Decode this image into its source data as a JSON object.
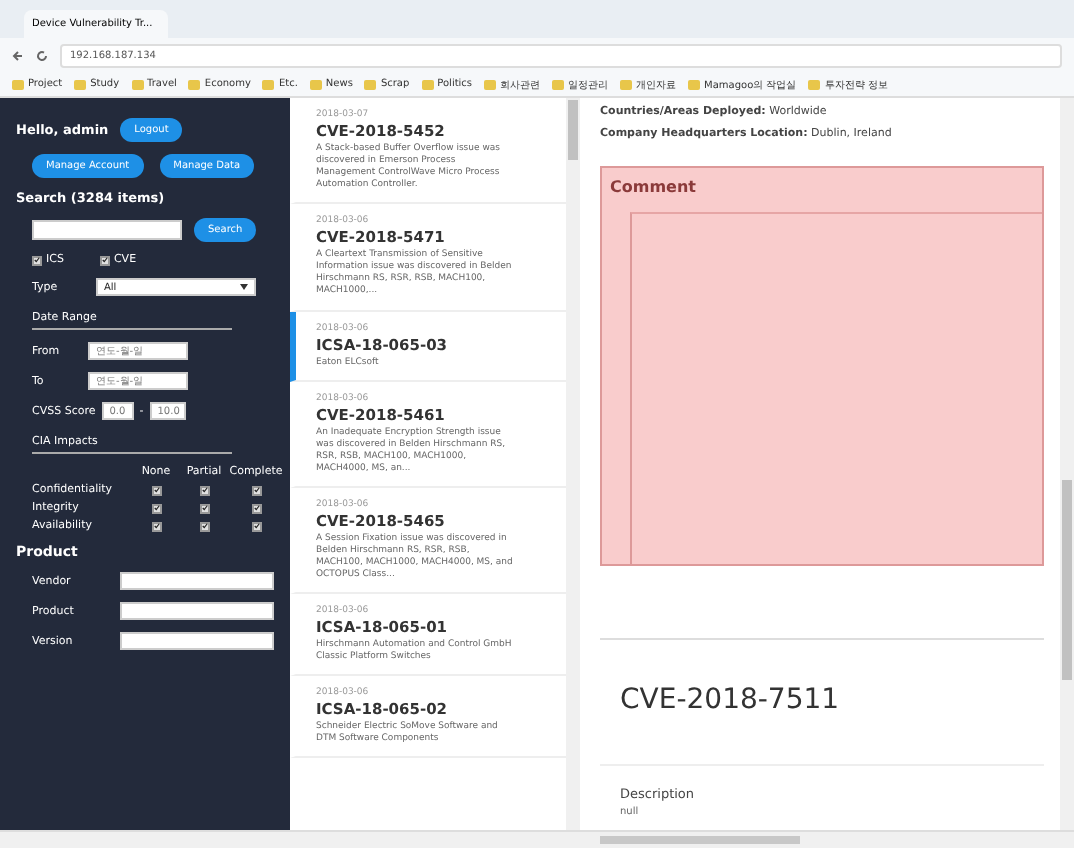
{
  "browser": {
    "tab_title": "Device Vulnerability Tr...",
    "address": "192.168.187.134",
    "bookmarks": [
      "Project",
      "Study",
      "Travel",
      "Economy",
      "Etc.",
      "News",
      "Scrap",
      "Politics",
      "회사관련",
      "일정관리",
      "개인자료",
      "Mamagoo의 작업실",
      "투자전략 정보"
    ]
  },
  "sidebar": {
    "greeting": "Hello, admin",
    "logout": "Logout",
    "buttons": [
      "Manage Account",
      "Manage Data"
    ],
    "search": {
      "title": "Search (3284 items)",
      "button": "Search",
      "filters": [
        {
          "label": "ICS",
          "checked": true
        },
        {
          "label": "CVE",
          "checked": true
        }
      ],
      "type": {
        "label": "Type",
        "value": "All"
      },
      "date_range": {
        "title": "Date Range",
        "fields": [
          {
            "label": "From",
            "placeholder": "연도-월-일"
          },
          {
            "label": "To",
            "placeholder": "연도-월-일"
          }
        ]
      },
      "cvss": {
        "label": "CVSS Score",
        "min": "0.0",
        "separator": "-",
        "max": "10.0"
      },
      "cia": {
        "title": "CIA Impacts",
        "columns": [
          "None",
          "Partial",
          "Complete"
        ],
        "rows": [
          {
            "label": "Confidentiality",
            "checks": [
              true,
              true,
              true
            ]
          },
          {
            "label": "Integrity",
            "checks": [
              true,
              true,
              true
            ]
          },
          {
            "label": "Availability",
            "checks": [
              true,
              true,
              true
            ]
          }
        ]
      }
    },
    "product": {
      "title": "Product",
      "fields": [
        "Vendor",
        "Product",
        "Version"
      ]
    }
  },
  "list": [
    {
      "date": "2018-03-07",
      "id": "CVE-2018-5452",
      "summary": "A Stack-based Buffer Overflow issue was discovered in Emerson Process Management ControlWave Micro Process Automation Controller.",
      "selected": false
    },
    {
      "date": "2018-03-06",
      "id": "CVE-2018-5471",
      "summary": "A Cleartext Transmission of Sensitive Information issue was discovered in Belden Hirschmann RS, RSR, RSB, MACH100, MACH1000,...",
      "selected": false
    },
    {
      "date": "2018-03-06",
      "id": "ICSA-18-065-03",
      "summary": "Eaton ELCsoft",
      "selected": true
    },
    {
      "date": "2018-03-06",
      "id": "CVE-2018-5461",
      "summary": "An Inadequate Encryption Strength issue was discovered in Belden Hirschmann RS, RSR, RSB, MACH100, MACH1000, MACH4000, MS, an...",
      "selected": false
    },
    {
      "date": "2018-03-06",
      "id": "CVE-2018-5465",
      "summary": "A Session Fixation issue was discovered in Belden Hirschmann RS, RSR, RSB, MACH100, MACH1000, MACH4000, MS, and OCTOPUS Class...",
      "selected": false
    },
    {
      "date": "2018-03-06",
      "id": "ICSA-18-065-01",
      "summary": "Hirschmann Automation and Control GmbH Classic Platform Switches",
      "selected": false
    },
    {
      "date": "2018-03-06",
      "id": "ICSA-18-065-02",
      "summary": "Schneider Electric SoMove Software and DTM Software Components",
      "selected": false
    }
  ],
  "detail": {
    "facts": [
      {
        "label": "Countries/Areas Deployed:",
        "value": "Worldwide"
      },
      {
        "label": "Company Headquarters Location:",
        "value": "Dublin, Ireland"
      }
    ],
    "comment": {
      "title": "Comment"
    },
    "heading": "CVE-2018-7511",
    "section": "Description",
    "section_text": "null"
  }
}
